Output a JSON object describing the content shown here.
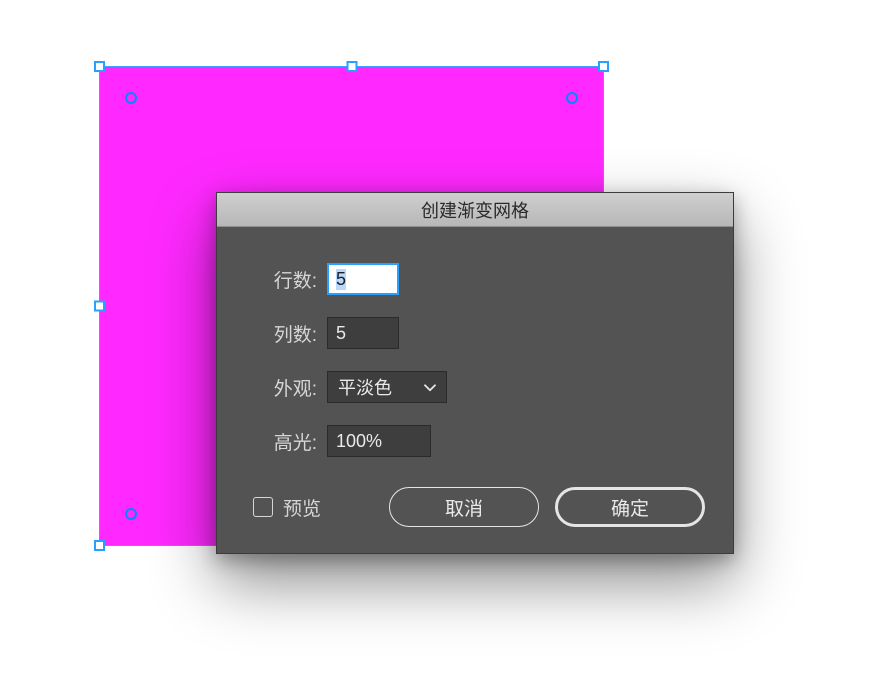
{
  "canvas": {
    "selected_shape": "rectangle",
    "fill_color": "#ff29ff",
    "selection_color": "#27a0ff"
  },
  "dialog": {
    "title": "创建渐变网格",
    "fields": {
      "rows": {
        "label": "行数:",
        "value": "5"
      },
      "cols": {
        "label": "列数:",
        "value": "5"
      },
      "appearance": {
        "label": "外观:",
        "selected": "平淡色"
      },
      "highlight": {
        "label": "高光:",
        "value": "100%"
      }
    },
    "preview": {
      "label": "预览",
      "checked": false
    },
    "buttons": {
      "cancel": "取消",
      "ok": "确定"
    }
  }
}
